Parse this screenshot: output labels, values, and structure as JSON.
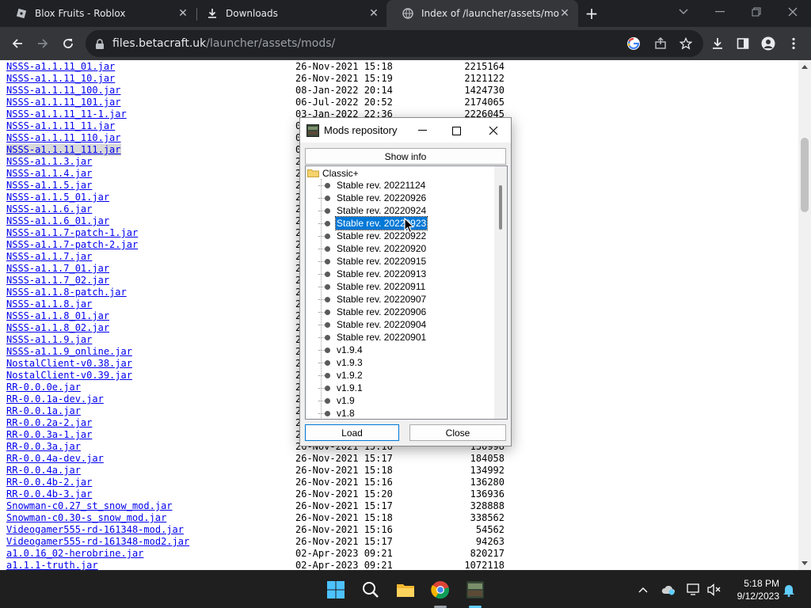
{
  "tabs": [
    {
      "title": "Blox Fruits - Roblox",
      "icon": "roblox-icon"
    },
    {
      "title": "Downloads",
      "icon": "download-icon"
    },
    {
      "title": "Index of /launcher/assets/mods/",
      "icon": "globe-icon"
    }
  ],
  "address": {
    "host": "files.betacraft.uk",
    "path": "/launcher/assets/mods/"
  },
  "listing": [
    {
      "name": "NSSS-a1.1.11_01.jar",
      "date": "26-Nov-2021 15:18",
      "size": "2215164"
    },
    {
      "name": "NSSS-a1.1.11_10.jar",
      "date": "26-Nov-2021 15:19",
      "size": "2121122"
    },
    {
      "name": "NSSS-a1.1.11_100.jar",
      "date": "08-Jan-2022 20:14",
      "size": "1424730"
    },
    {
      "name": "NSSS-a1.1.11_101.jar",
      "date": "06-Jul-2022 20:52",
      "size": "2174065"
    },
    {
      "name": "NSSS-a1.1.11_11-1.jar",
      "date": "03-Jan-2022 22:36",
      "size": "2226045"
    },
    {
      "name": "NSSS-a1.1.11_11.jar",
      "date": "0",
      "size": ""
    },
    {
      "name": "NSSS-a1.1.11_110.jar",
      "date": "0",
      "size": ""
    },
    {
      "name": "NSSS-a1.1.11_111.jar",
      "date": "0",
      "size": ""
    },
    {
      "name": "NSSS-a1.1.3.jar",
      "date": "2",
      "size": ""
    },
    {
      "name": "NSSS-a1.1.4.jar",
      "date": "2",
      "size": ""
    },
    {
      "name": "NSSS-a1.1.5.jar",
      "date": "2",
      "size": ""
    },
    {
      "name": "NSSS-a1.1.5_01.jar",
      "date": "2",
      "size": ""
    },
    {
      "name": "NSSS-a1.1.6.jar",
      "date": "2",
      "size": ""
    },
    {
      "name": "NSSS-a1.1.6_01.jar",
      "date": "2",
      "size": ""
    },
    {
      "name": "NSSS-a1.1.7-patch-1.jar",
      "date": "2",
      "size": ""
    },
    {
      "name": "NSSS-a1.1.7-patch-2.jar",
      "date": "2",
      "size": ""
    },
    {
      "name": "NSSS-a1.1.7.jar",
      "date": "2",
      "size": ""
    },
    {
      "name": "NSSS-a1.1.7_01.jar",
      "date": "2",
      "size": ""
    },
    {
      "name": "NSSS-a1.1.7_02.jar",
      "date": "2",
      "size": ""
    },
    {
      "name": "NSSS-a1.1.8-patch.jar",
      "date": "2",
      "size": ""
    },
    {
      "name": "NSSS-a1.1.8.jar",
      "date": "2",
      "size": ""
    },
    {
      "name": "NSSS-a1.1.8_01.jar",
      "date": "2",
      "size": ""
    },
    {
      "name": "NSSS-a1.1.8_02.jar",
      "date": "2",
      "size": ""
    },
    {
      "name": "NSSS-a1.1.9.jar",
      "date": "2",
      "size": ""
    },
    {
      "name": "NSSS-a1.1.9_online.jar",
      "date": "2",
      "size": ""
    },
    {
      "name": "NostalClient-v0.38.jar",
      "date": "2",
      "size": ""
    },
    {
      "name": "NostalClient-v0.39.jar",
      "date": "2",
      "size": ""
    },
    {
      "name": "RR-0.0.0e.jar",
      "date": "2",
      "size": ""
    },
    {
      "name": "RR-0.0.1a-dev.jar",
      "date": "2",
      "size": ""
    },
    {
      "name": "RR-0.0.1a.jar",
      "date": "2",
      "size": ""
    },
    {
      "name": "RR-0.0.2a-2.jar",
      "date": "2",
      "size": ""
    },
    {
      "name": "RR-0.0.3a-1.jar",
      "date": "2",
      "size": ""
    },
    {
      "name": "RR-0.0.3a.jar",
      "date": "26-Nov-2021 15:16",
      "size": "130998"
    },
    {
      "name": "RR-0.0.4a-dev.jar",
      "date": "26-Nov-2021 15:17",
      "size": "184058"
    },
    {
      "name": "RR-0.0.4a.jar",
      "date": "26-Nov-2021 15:18",
      "size": "134992"
    },
    {
      "name": "RR-0.0.4b-2.jar",
      "date": "26-Nov-2021 15:16",
      "size": "136280"
    },
    {
      "name": "RR-0.0.4b-3.jar",
      "date": "26-Nov-2021 15:20",
      "size": "136936"
    },
    {
      "name": "Snowman-c0.27_st_snow_mod.jar",
      "date": "26-Nov-2021 15:17",
      "size": "328888"
    },
    {
      "name": "Snowman-c0.30-s_snow_mod.jar",
      "date": "26-Nov-2021 15:18",
      "size": "338562"
    },
    {
      "name": "Videogamer555-rd-161348-mod.jar",
      "date": "26-Nov-2021 15:16",
      "size": "54562"
    },
    {
      "name": "Videogamer555-rd-161348-mod2.jar",
      "date": "26-Nov-2021 15:17",
      "size": "94263"
    },
    {
      "name": "a1.0.16_02-herobrine.jar",
      "date": "02-Apr-2023 09:21",
      "size": "820217"
    },
    {
      "name": "a1.1.1-truth.jar",
      "date": "02-Apr-2023 09:21",
      "size": "1072118"
    }
  ],
  "dialog": {
    "title": "Mods repository",
    "show_info": "Show info",
    "root": "Classic+",
    "items": [
      "Stable rev. 20221124",
      "Stable rev. 20220926",
      "Stable rev. 20220924",
      "Stable rev. 20220923",
      "Stable rev. 20220922",
      "Stable rev. 20220920",
      "Stable rev. 20220915",
      "Stable rev. 20220913",
      "Stable rev. 20220911",
      "Stable rev. 20220907",
      "Stable rev. 20220906",
      "Stable rev. 20220904",
      "Stable rev. 20220901",
      "v1.9.4",
      "v1.9.3",
      "v1.9.2",
      "v1.9.1",
      "v1.9",
      "v1.8"
    ],
    "load": "Load",
    "close": "Close"
  },
  "clock": {
    "time": "5:18 PM",
    "date": "9/12/2023"
  },
  "colors": {
    "link": "#0000ee",
    "selection": "#0078d7",
    "chrome_dark": "#202124",
    "chrome_toolbar": "#35363a"
  }
}
